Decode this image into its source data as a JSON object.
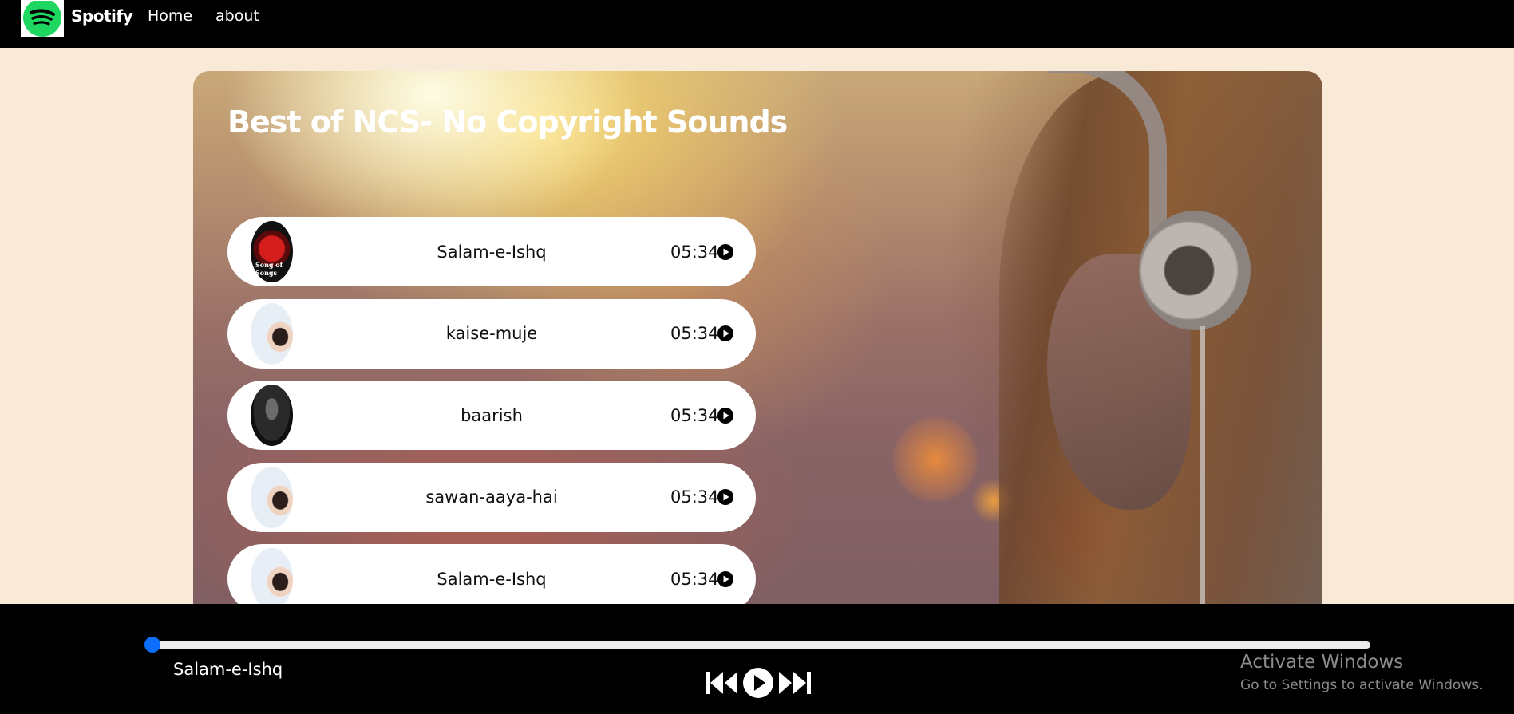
{
  "navbar": {
    "brand": "Spotify",
    "links": [
      "Home",
      "about"
    ],
    "logo_icon": "spotify-logo-icon",
    "logo_color": "#1ed760"
  },
  "main": {
    "title": "Best of NCS- No Copyright Sounds",
    "songs": [
      {
        "name": "Salam-e-Ishq",
        "duration": "05:34",
        "cover_icon": "song-cover-red"
      },
      {
        "name": "kaise-muje",
        "duration": "05:34",
        "cover_icon": "song-cover-portrait"
      },
      {
        "name": "baarish",
        "duration": "05:34",
        "cover_icon": "song-cover-dark"
      },
      {
        "name": "sawan-aaya-hai",
        "duration": "05:34",
        "cover_icon": "song-cover-portrait"
      },
      {
        "name": "Salam-e-Ishq",
        "duration": "05:34",
        "cover_icon": "song-cover-portrait"
      }
    ],
    "cover_text": {
      "red": "Song of Songs",
      "dark": ""
    }
  },
  "player": {
    "current_song": "Salam-e-Ishq",
    "progress_percent": 0,
    "accent_color": "#0b6efd",
    "controls": [
      "previous-icon",
      "play-icon",
      "next-icon"
    ]
  },
  "watermark": {
    "title": "Activate Windows",
    "subtitle": "Go to Settings to activate Windows."
  }
}
